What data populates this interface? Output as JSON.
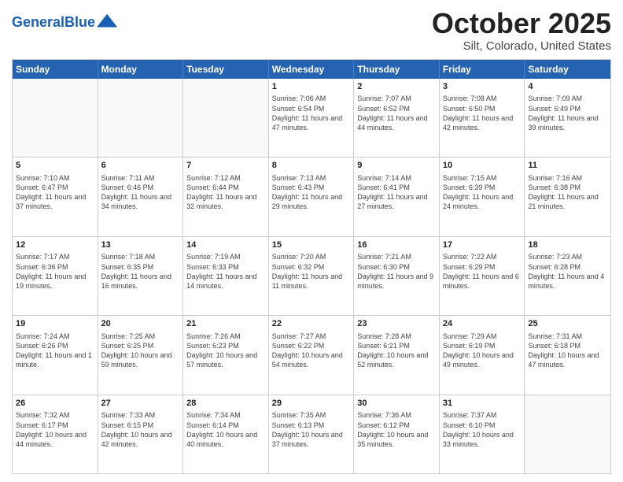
{
  "header": {
    "logo_general": "General",
    "logo_blue": "Blue",
    "month_title": "October 2025",
    "location": "Silt, Colorado, United States"
  },
  "weekdays": [
    "Sunday",
    "Monday",
    "Tuesday",
    "Wednesday",
    "Thursday",
    "Friday",
    "Saturday"
  ],
  "rows": [
    [
      {
        "day": "",
        "info": ""
      },
      {
        "day": "",
        "info": ""
      },
      {
        "day": "",
        "info": ""
      },
      {
        "day": "1",
        "info": "Sunrise: 7:06 AM\nSunset: 6:54 PM\nDaylight: 11 hours and 47 minutes."
      },
      {
        "day": "2",
        "info": "Sunrise: 7:07 AM\nSunset: 6:52 PM\nDaylight: 11 hours and 44 minutes."
      },
      {
        "day": "3",
        "info": "Sunrise: 7:08 AM\nSunset: 6:50 PM\nDaylight: 11 hours and 42 minutes."
      },
      {
        "day": "4",
        "info": "Sunrise: 7:09 AM\nSunset: 6:49 PM\nDaylight: 11 hours and 39 minutes."
      }
    ],
    [
      {
        "day": "5",
        "info": "Sunrise: 7:10 AM\nSunset: 6:47 PM\nDaylight: 11 hours and 37 minutes."
      },
      {
        "day": "6",
        "info": "Sunrise: 7:11 AM\nSunset: 6:46 PM\nDaylight: 11 hours and 34 minutes."
      },
      {
        "day": "7",
        "info": "Sunrise: 7:12 AM\nSunset: 6:44 PM\nDaylight: 11 hours and 32 minutes."
      },
      {
        "day": "8",
        "info": "Sunrise: 7:13 AM\nSunset: 6:43 PM\nDaylight: 11 hours and 29 minutes."
      },
      {
        "day": "9",
        "info": "Sunrise: 7:14 AM\nSunset: 6:41 PM\nDaylight: 11 hours and 27 minutes."
      },
      {
        "day": "10",
        "info": "Sunrise: 7:15 AM\nSunset: 6:39 PM\nDaylight: 11 hours and 24 minutes."
      },
      {
        "day": "11",
        "info": "Sunrise: 7:16 AM\nSunset: 6:38 PM\nDaylight: 11 hours and 21 minutes."
      }
    ],
    [
      {
        "day": "12",
        "info": "Sunrise: 7:17 AM\nSunset: 6:36 PM\nDaylight: 11 hours and 19 minutes."
      },
      {
        "day": "13",
        "info": "Sunrise: 7:18 AM\nSunset: 6:35 PM\nDaylight: 11 hours and 16 minutes."
      },
      {
        "day": "14",
        "info": "Sunrise: 7:19 AM\nSunset: 6:33 PM\nDaylight: 11 hours and 14 minutes."
      },
      {
        "day": "15",
        "info": "Sunrise: 7:20 AM\nSunset: 6:32 PM\nDaylight: 11 hours and 11 minutes."
      },
      {
        "day": "16",
        "info": "Sunrise: 7:21 AM\nSunset: 6:30 PM\nDaylight: 11 hours and 9 minutes."
      },
      {
        "day": "17",
        "info": "Sunrise: 7:22 AM\nSunset: 6:29 PM\nDaylight: 11 hours and 6 minutes."
      },
      {
        "day": "18",
        "info": "Sunrise: 7:23 AM\nSunset: 6:28 PM\nDaylight: 11 hours and 4 minutes."
      }
    ],
    [
      {
        "day": "19",
        "info": "Sunrise: 7:24 AM\nSunset: 6:26 PM\nDaylight: 11 hours and 1 minute."
      },
      {
        "day": "20",
        "info": "Sunrise: 7:25 AM\nSunset: 6:25 PM\nDaylight: 10 hours and 59 minutes."
      },
      {
        "day": "21",
        "info": "Sunrise: 7:26 AM\nSunset: 6:23 PM\nDaylight: 10 hours and 57 minutes."
      },
      {
        "day": "22",
        "info": "Sunrise: 7:27 AM\nSunset: 6:22 PM\nDaylight: 10 hours and 54 minutes."
      },
      {
        "day": "23",
        "info": "Sunrise: 7:28 AM\nSunset: 6:21 PM\nDaylight: 10 hours and 52 minutes."
      },
      {
        "day": "24",
        "info": "Sunrise: 7:29 AM\nSunset: 6:19 PM\nDaylight: 10 hours and 49 minutes."
      },
      {
        "day": "25",
        "info": "Sunrise: 7:31 AM\nSunset: 6:18 PM\nDaylight: 10 hours and 47 minutes."
      }
    ],
    [
      {
        "day": "26",
        "info": "Sunrise: 7:32 AM\nSunset: 6:17 PM\nDaylight: 10 hours and 44 minutes."
      },
      {
        "day": "27",
        "info": "Sunrise: 7:33 AM\nSunset: 6:15 PM\nDaylight: 10 hours and 42 minutes."
      },
      {
        "day": "28",
        "info": "Sunrise: 7:34 AM\nSunset: 6:14 PM\nDaylight: 10 hours and 40 minutes."
      },
      {
        "day": "29",
        "info": "Sunrise: 7:35 AM\nSunset: 6:13 PM\nDaylight: 10 hours and 37 minutes."
      },
      {
        "day": "30",
        "info": "Sunrise: 7:36 AM\nSunset: 6:12 PM\nDaylight: 10 hours and 35 minutes."
      },
      {
        "day": "31",
        "info": "Sunrise: 7:37 AM\nSunset: 6:10 PM\nDaylight: 10 hours and 33 minutes."
      },
      {
        "day": "",
        "info": ""
      }
    ]
  ]
}
